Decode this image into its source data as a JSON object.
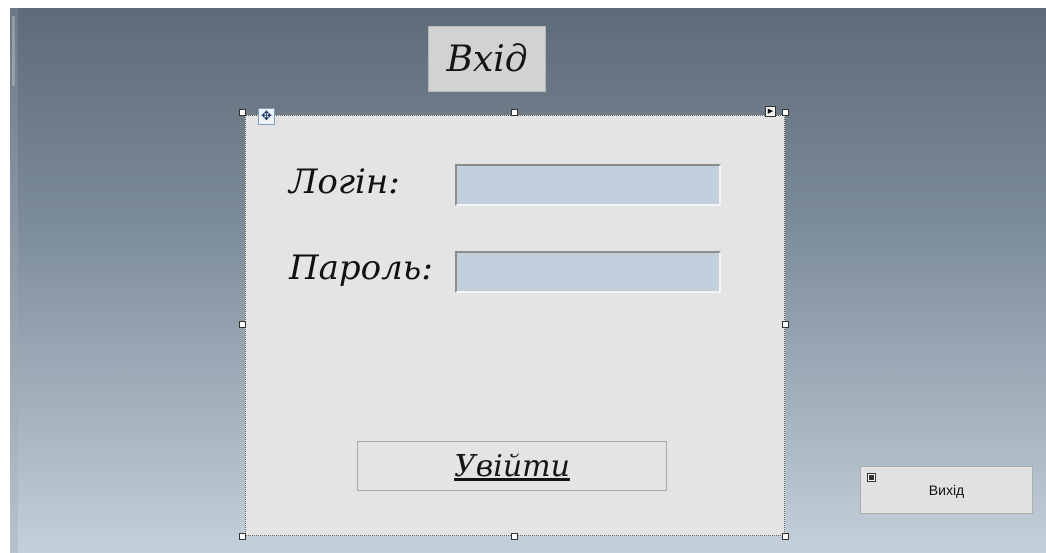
{
  "form": {
    "title": "Вхід",
    "login_label": "Логін:",
    "password_label": "Пароль:",
    "login_value": "",
    "password_value": "",
    "submit_label": "Увійти",
    "exit_label": "Вихід"
  },
  "designer": {
    "move_icon": "move-icon",
    "smart_tag_icon": "smart-tag-icon"
  },
  "colors": {
    "field_background": "#c2cfdc",
    "panel_background": "#e4e4e4",
    "form_background_top": "#5e6b78",
    "form_background_bottom": "#c4d0da"
  }
}
